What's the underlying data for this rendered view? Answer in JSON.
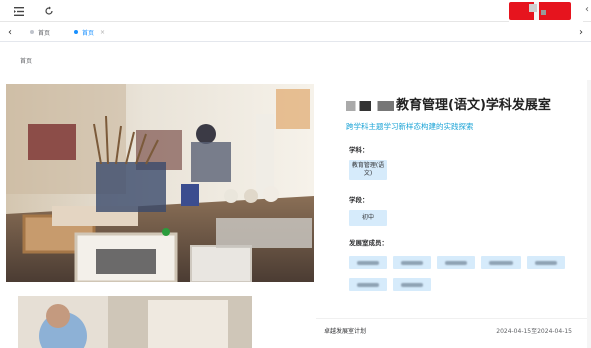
{
  "header": {
    "menu_icon": "menu-fold-icon",
    "refresh_icon": "refresh-icon"
  },
  "tabs": [
    {
      "label": "首页",
      "active": false
    },
    {
      "label": "首页",
      "active": true
    }
  ],
  "breadcrumb": {
    "current": "首页"
  },
  "studio": {
    "title": "教育管理(语文)学科发展室",
    "subtitle": "跨学科主题学习新样态构建的实践探索",
    "subject_label": "学科：",
    "subject_value": "教育管理(语文)",
    "stage_label": "学段：",
    "stage_value": "初中",
    "members_label": "发展室成员："
  },
  "plan": {
    "name": "卓越发展室计划",
    "date_range": "2024-04-15至2024-04-15"
  },
  "colors": {
    "accent": "#1890ff",
    "subtitle": "#1aa3d6",
    "chip_bg": "#d6ebfb",
    "brand_red": "#e6141e"
  }
}
